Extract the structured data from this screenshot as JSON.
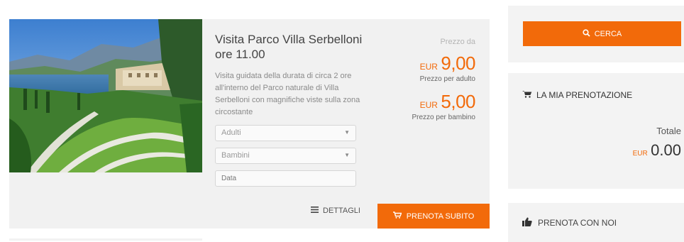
{
  "product": {
    "title": "Visita Parco Villa Serbelloni ore 11.00",
    "description": "Visita guidata della durata di circa 2 ore all'interno del Parco naturale di Villa Serbelloni con magnifiche viste sulla zona circostante",
    "selects": {
      "adults_placeholder": "Adulti",
      "children_placeholder": "Bambini"
    },
    "date_placeholder": "Data",
    "price_from_label": "Prezzo da",
    "adult_price": {
      "currency": "EUR",
      "amount": "9,00",
      "caption": "Prezzo per adulto"
    },
    "child_price": {
      "currency": "EUR",
      "amount": "5,00",
      "caption": "Prezzo per bambino"
    },
    "details_label": "DETTAGLI",
    "book_label": "PRENOTA SUBITO"
  },
  "sidebar": {
    "search_label": "CERCA",
    "booking_title": "LA MIA PRENOTAZIONE",
    "total_label": "Totale",
    "total_currency": "EUR",
    "total_amount": "0.00",
    "book_with_us": "PRENOTA CON NOI"
  },
  "colors": {
    "accent": "#f26a0a",
    "card_bg": "#f1f1f1"
  }
}
